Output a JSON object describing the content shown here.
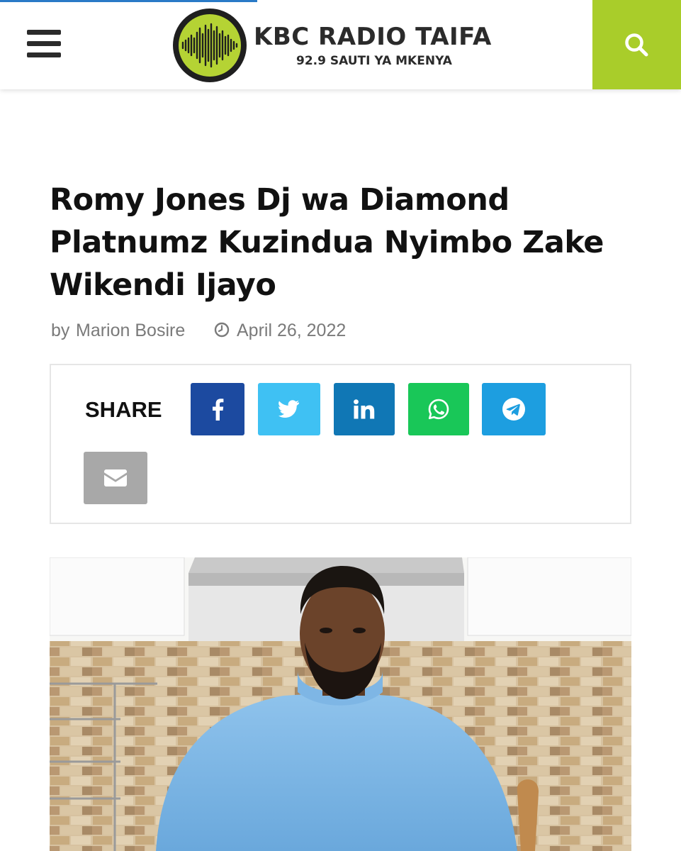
{
  "header": {
    "menu_icon": "hamburger-menu-icon",
    "logo": {
      "name": "KBC RADIO TAIFA",
      "tagline": "92.9 SAUTI YA MKENYA"
    },
    "search_icon": "search-icon",
    "accent_color": "#a9cd2a"
  },
  "article": {
    "title": "Romy Jones Dj wa Diamond Platnumz Kuzindua Nyimbo Zake Wikendi Ijayo",
    "byline_prefix": "by",
    "author": "Marion Bosire",
    "date_icon": "clock-icon",
    "date": "April 26, 2022"
  },
  "share": {
    "label": "SHARE",
    "buttons": [
      {
        "icon": "facebook-icon",
        "color": "#1c4aa0"
      },
      {
        "icon": "twitter-icon",
        "color": "#3fc1f3"
      },
      {
        "icon": "linkedin-icon",
        "color": "#1077b5"
      },
      {
        "icon": "whatsapp-icon",
        "color": "#19c758"
      },
      {
        "icon": "telegram-icon",
        "color": "#1d9ee0"
      },
      {
        "icon": "email-icon",
        "color": "#a8a8a8"
      }
    ]
  },
  "featured_image": {
    "subject": "man in light blue turtleneck sweater in a kitchen"
  }
}
